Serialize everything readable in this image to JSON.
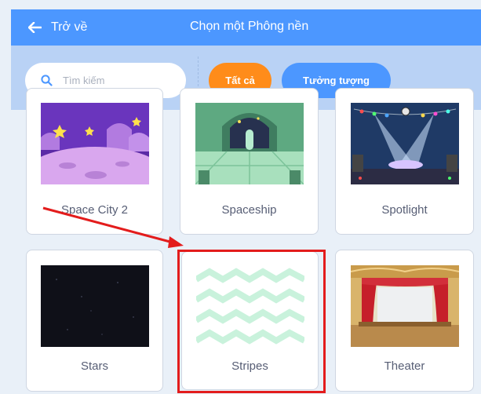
{
  "header": {
    "back_label": "Trở về",
    "title": "Chọn một Phông nền"
  },
  "filters": {
    "search_placeholder": "Tìm kiếm",
    "tags": [
      "Tất cả",
      "Tưởng tượng"
    ],
    "selected_tag": "Tất cả"
  },
  "backdrops": [
    {
      "name": "Space City 2"
    },
    {
      "name": "Spaceship"
    },
    {
      "name": "Spotlight"
    },
    {
      "name": "Stars"
    },
    {
      "name": "Stripes"
    },
    {
      "name": "Theater"
    }
  ],
  "colors": {
    "header": "#4c97ff",
    "filterbar": "#b9d2f5",
    "selected_tag": "#ff8c1a",
    "tag": "#4c97ff",
    "annotation": "#e31c1c"
  }
}
